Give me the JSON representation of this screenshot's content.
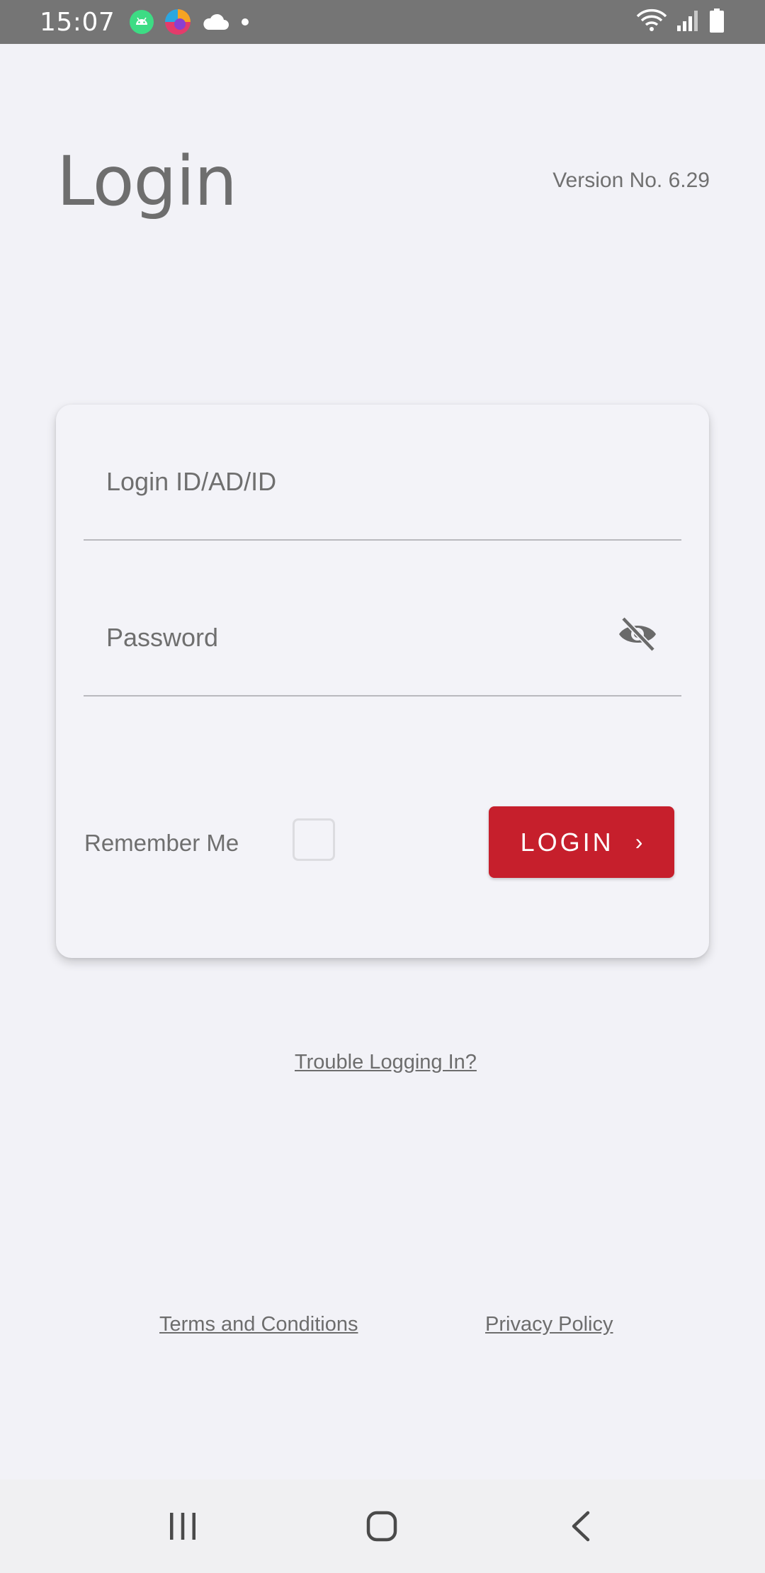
{
  "status_bar": {
    "time": "15:07",
    "icons": [
      "android-icon",
      "colorful-app-icon",
      "cloud-icon",
      "dot-icon"
    ],
    "right_icons": [
      "wifi-icon",
      "signal-icon",
      "battery-icon"
    ]
  },
  "header": {
    "title": "Login",
    "version": "Version No. 6.29"
  },
  "form": {
    "login_id_placeholder": "Login ID/AD/ID",
    "password_placeholder": "Password",
    "remember_me_label": "Remember Me",
    "remember_me_checked": false,
    "login_button_label": "LOGIN",
    "login_button_chevron": "›",
    "password_toggle_icon": "eye-off-icon"
  },
  "links": {
    "trouble": "Trouble Logging In?",
    "terms": "Terms and Conditions",
    "privacy": "Privacy Policy"
  },
  "colors": {
    "accent": "#c61f2c",
    "background": "#f2f2f7",
    "status_bar": "#757575"
  },
  "nav_bar": {
    "buttons": [
      "recents-icon",
      "home-icon",
      "back-icon"
    ]
  }
}
